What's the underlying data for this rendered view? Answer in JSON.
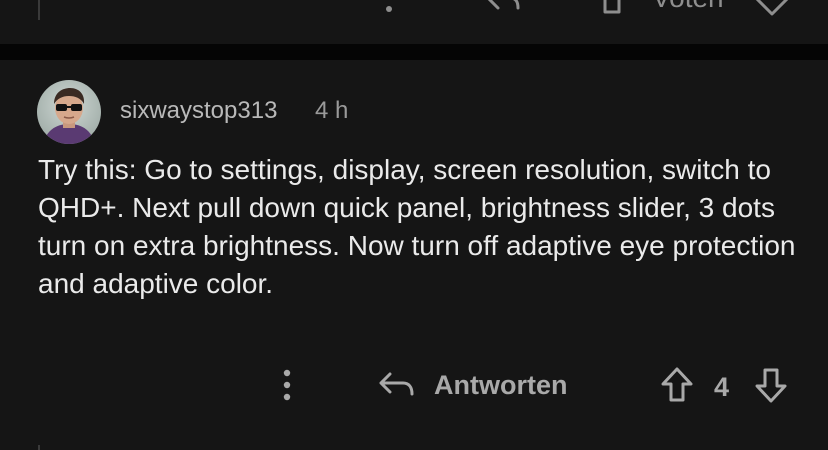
{
  "previous_comment": {
    "vote_label": "Voten"
  },
  "comment": {
    "username": "sixwaystop313",
    "timestamp": "4 h",
    "body": "Try this: Go to settings, display, screen resolution, switch to QHD+. Next pull down quick panel, brightness slider, 3 dots turn on extra brightness. Now turn off adaptive eye protection and adaptive color.",
    "actions": {
      "more_icon": "more-vertical-icon",
      "reply_icon": "reply-arrow-icon",
      "reply_label": "Antworten",
      "upvote_icon": "arrow-up-icon",
      "score": "4",
      "downvote_icon": "arrow-down-icon"
    }
  },
  "colors": {
    "background": "#151515",
    "separator": "#050505",
    "body_text": "#eaeaea",
    "muted_text": "#a9a9a9"
  }
}
